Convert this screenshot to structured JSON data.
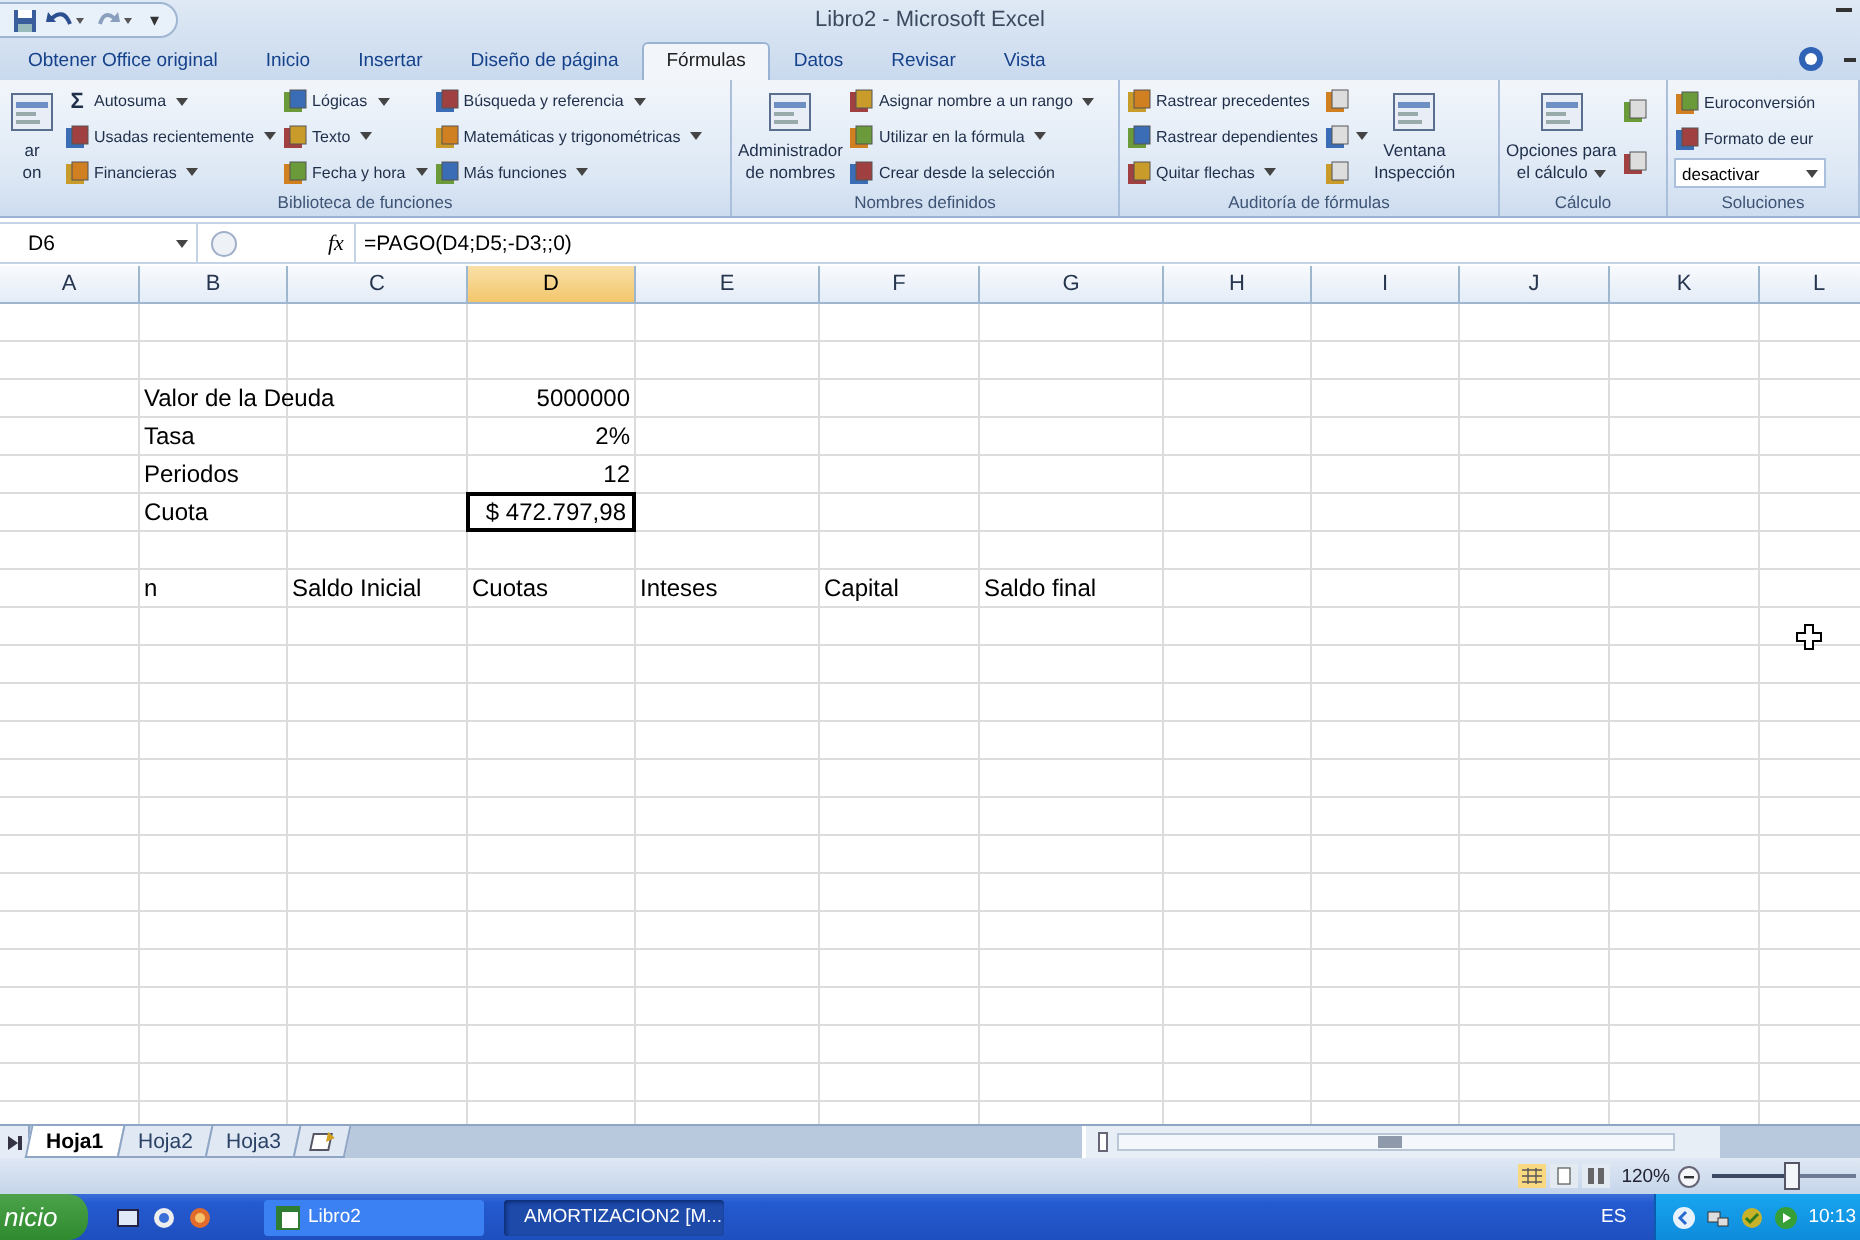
{
  "title_bar": {
    "title": "Libro2 - Microsoft Excel",
    "quick_access_more": "▾"
  },
  "tabs": [
    {
      "label": "Obtener Office original",
      "selected": false
    },
    {
      "label": "Inicio",
      "selected": false
    },
    {
      "label": "Insertar",
      "selected": false
    },
    {
      "label": "Diseño de página",
      "selected": false
    },
    {
      "label": "Fórmulas",
      "selected": true
    },
    {
      "label": "Datos",
      "selected": false
    },
    {
      "label": "Revisar",
      "selected": false
    },
    {
      "label": "Vista",
      "selected": false
    }
  ],
  "ribbon_groups": [
    {
      "title": "Biblioteca de funciones",
      "items": [
        {
          "kind": "large",
          "label": "ar\non",
          "dropdown": false
        },
        {
          "kind": "small",
          "label": "Autosuma",
          "glyph": "Σ",
          "dropdown": true
        },
        {
          "kind": "small",
          "label": "Usadas recientemente",
          "dropdown": true
        },
        {
          "kind": "small",
          "label": "Financieras",
          "dropdown": true
        },
        {
          "kind": "small",
          "label": "Lógicas",
          "dropdown": true
        },
        {
          "kind": "small",
          "label": "Texto",
          "dropdown": true
        },
        {
          "kind": "small",
          "label": "Fecha y hora",
          "dropdown": true
        },
        {
          "kind": "small",
          "label": "Búsqueda y referencia",
          "dropdown": true
        },
        {
          "kind": "small",
          "label": "Matemáticas y trigonométricas",
          "dropdown": true
        },
        {
          "kind": "small",
          "label": "Más funciones",
          "dropdown": true
        }
      ]
    },
    {
      "title": "Nombres definidos",
      "items": [
        {
          "kind": "large",
          "label": "Administrador\nde nombres",
          "dropdown": false
        },
        {
          "kind": "small",
          "label": "Asignar nombre a un rango",
          "dropdown": true
        },
        {
          "kind": "small",
          "label": "Utilizar en la fórmula",
          "dropdown": true
        },
        {
          "kind": "small",
          "label": "Crear desde la selección",
          "dropdown": false
        }
      ]
    },
    {
      "title": "Auditoría de fórmulas",
      "items": [
        {
          "kind": "small",
          "label": "Rastrear precedentes",
          "dropdown": false
        },
        {
          "kind": "small",
          "label": "Rastrear dependientes",
          "dropdown": false
        },
        {
          "kind": "small",
          "label": "Quitar flechas",
          "dropdown": true
        },
        {
          "kind": "icon",
          "dropdown": false
        },
        {
          "kind": "icon",
          "dropdown": true
        },
        {
          "kind": "icon",
          "dropdown": false
        },
        {
          "kind": "large",
          "label": "Ventana\nInspección",
          "dropdown": false
        }
      ]
    },
    {
      "title": "Cálculo",
      "items": [
        {
          "kind": "large",
          "label": "Opciones para\nel cálculo",
          "dropdown": true
        },
        {
          "kind": "icon",
          "dropdown": false
        },
        {
          "kind": "icon",
          "dropdown": false
        }
      ]
    },
    {
      "title": "Soluciones",
      "items": [
        {
          "kind": "small",
          "label": "Euroconversión",
          "dropdown": false
        },
        {
          "kind": "small",
          "label": "Formato de eur",
          "dropdown": false
        },
        {
          "kind": "select",
          "label": "desactivar",
          "dropdown": true
        }
      ]
    }
  ],
  "formula_bar": {
    "name_box": "D6",
    "function_button": "fx",
    "formula": "=PAGO(D4;D5;-D3;;0)"
  },
  "columns": [
    {
      "letter": "A",
      "selected": false
    },
    {
      "letter": "B",
      "selected": false
    },
    {
      "letter": "C",
      "selected": false
    },
    {
      "letter": "D",
      "selected": true
    },
    {
      "letter": "E",
      "selected": false
    },
    {
      "letter": "F",
      "selected": false
    },
    {
      "letter": "G",
      "selected": false
    },
    {
      "letter": "H",
      "selected": false
    },
    {
      "letter": "I",
      "selected": false
    },
    {
      "letter": "J",
      "selected": false
    },
    {
      "letter": "K",
      "selected": false
    },
    {
      "letter": "L",
      "selected": false
    }
  ],
  "rows": [
    {},
    {},
    {
      "cells": [
        {},
        {
          "kind": "text",
          "text": "Valor de la Deuda",
          "selected": false
        },
        {},
        {
          "kind": "number",
          "text": "5000000",
          "selected": false
        }
      ]
    },
    {
      "cells": [
        {},
        {
          "kind": "text",
          "text": "Tasa",
          "selected": false
        },
        {},
        {
          "kind": "number",
          "text": "2%",
          "selected": false
        }
      ]
    },
    {
      "cells": [
        {},
        {
          "kind": "text",
          "text": "Periodos",
          "selected": false
        },
        {},
        {
          "kind": "number",
          "text": "12",
          "selected": false
        }
      ]
    },
    {
      "cells": [
        {},
        {
          "kind": "text",
          "text": "Cuota",
          "selected": false
        },
        {},
        {
          "kind": "number",
          "text": "$ 472.797,98",
          "selected": true
        }
      ]
    },
    {},
    {
      "cells": [
        {},
        {
          "kind": "text",
          "text": "n",
          "selected": false
        },
        {
          "kind": "text",
          "text": "Saldo Inicial",
          "selected": false
        },
        {
          "kind": "text",
          "text": "Cuotas",
          "selected": false
        },
        {
          "kind": "text",
          "text": "Inteses",
          "selected": false
        },
        {
          "kind": "text",
          "text": "Capital",
          "selected": false
        },
        {
          "kind": "text",
          "text": "Saldo final",
          "selected": false
        }
      ]
    },
    {},
    {},
    {},
    {},
    {},
    {},
    {},
    {},
    {},
    {},
    {},
    {},
    {},
    {}
  ],
  "sheet_tabs": [
    {
      "label": "Hoja1",
      "selected": true
    },
    {
      "label": "Hoja2",
      "selected": false
    },
    {
      "label": "Hoja3",
      "selected": false
    }
  ],
  "status_bar": {
    "zoom": "120%",
    "zoom_slider": {
      "level": 0.55
    }
  },
  "taskbar": {
    "start": "nicio",
    "tasks": [
      {
        "label": "Libro2",
        "selected": false
      },
      {
        "label": "AMORTIZACION2 [M...",
        "selected": true
      }
    ],
    "language": "ES",
    "clock": "10:13"
  }
}
